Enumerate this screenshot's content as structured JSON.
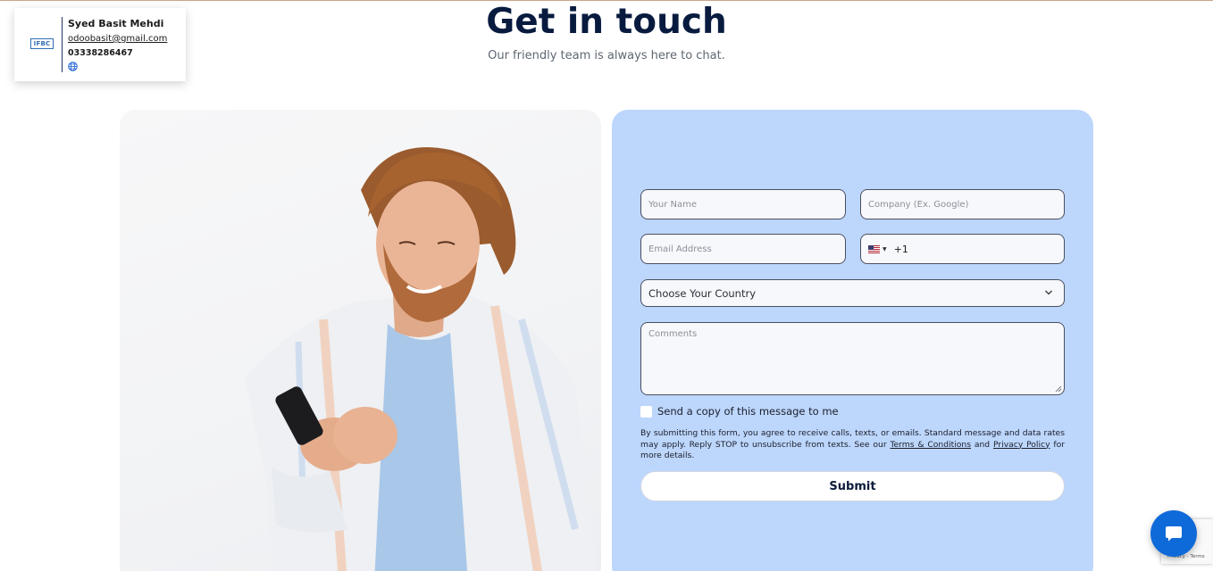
{
  "card": {
    "logo": "IFBC",
    "name": "Syed Basit Mehdi",
    "email": "odoobasit@gmail.com",
    "phone": "03338286467",
    "globe_icon": "globe-icon"
  },
  "header": {
    "title": "Get in touch",
    "subtitle": "Our friendly team is always here to chat."
  },
  "form": {
    "name_placeholder": "Your Name",
    "company_placeholder": "Company (Ex. Google)",
    "email_placeholder": "Email Address",
    "phone_code": "+1",
    "phone_flag": "us-flag-icon",
    "country_select": "Choose Your Country",
    "comments_placeholder": "Comments",
    "copy_label": "Send a copy of this message to me",
    "disclaimer_text": "By submitting this form, you agree to receive calls, texts, or emails. Standard message and data rates may apply. Reply STOP to unsubscribe from texts. See our",
    "terms_link": "Terms & Conditions",
    "and_text": "and",
    "privacy_link": "Privacy Policy",
    "details_text": "for more details.",
    "submit_label": "Submit"
  },
  "recaptcha": {
    "text": "Privacy - Terms"
  },
  "colors": {
    "form_bg": "#bdd6fc",
    "title": "#081b3f",
    "chat": "#0f6ad9"
  }
}
